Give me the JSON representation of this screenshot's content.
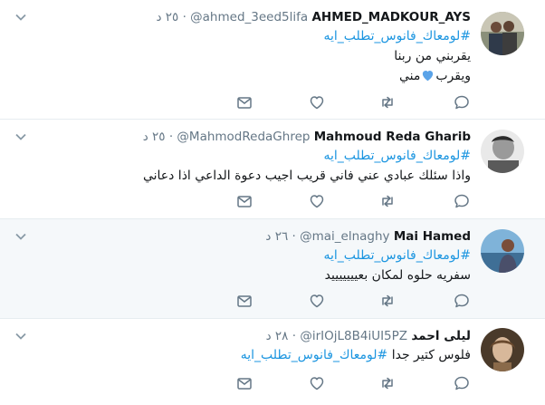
{
  "colors": {
    "hashtag": "#1b95e0",
    "secondary": "#657786",
    "border": "#e6ecf0",
    "hover_bg": "#f5f8fa"
  },
  "tweets": [
    {
      "name": "AHMED_MADKOUR_AYS",
      "handle": "@ahmed_3eed5lifa",
      "time": "٢٥ د",
      "hashtag": "#لومعاك_فانوس_تطلب_ايه",
      "lines": [
        "يقربني من ربنا",
        "ويقرب",
        "مني"
      ],
      "emoji": "blue-heart"
    },
    {
      "name": "Mahmoud Reda Gharib",
      "handle": "@MahmodRedaGhrep",
      "time": "٢٥ د",
      "hashtag": "#لومعاك_فانوس_تطلب_ايه",
      "lines": [
        "واذا سئلك عبادي عني فاني قريب اجيب دعوة الداعي اذا دعاني"
      ]
    },
    {
      "name": "Mai Hamed",
      "handle": "@mai_elnaghy",
      "time": "٢٦ د",
      "hashtag": "#لومعاك_فانوس_تطلب_ايه",
      "lines": [
        "سفريه حلوه لمكان بعيييييييد"
      ]
    },
    {
      "name": "ليلى احمد",
      "handle": "@irIOjL8B4iUI5PZ",
      "time": "٢٨ د",
      "text_prefix": "فلوس كتير جدا",
      "hashtag": "#لومعاك_فانوس_تطلب_ايه"
    }
  ]
}
